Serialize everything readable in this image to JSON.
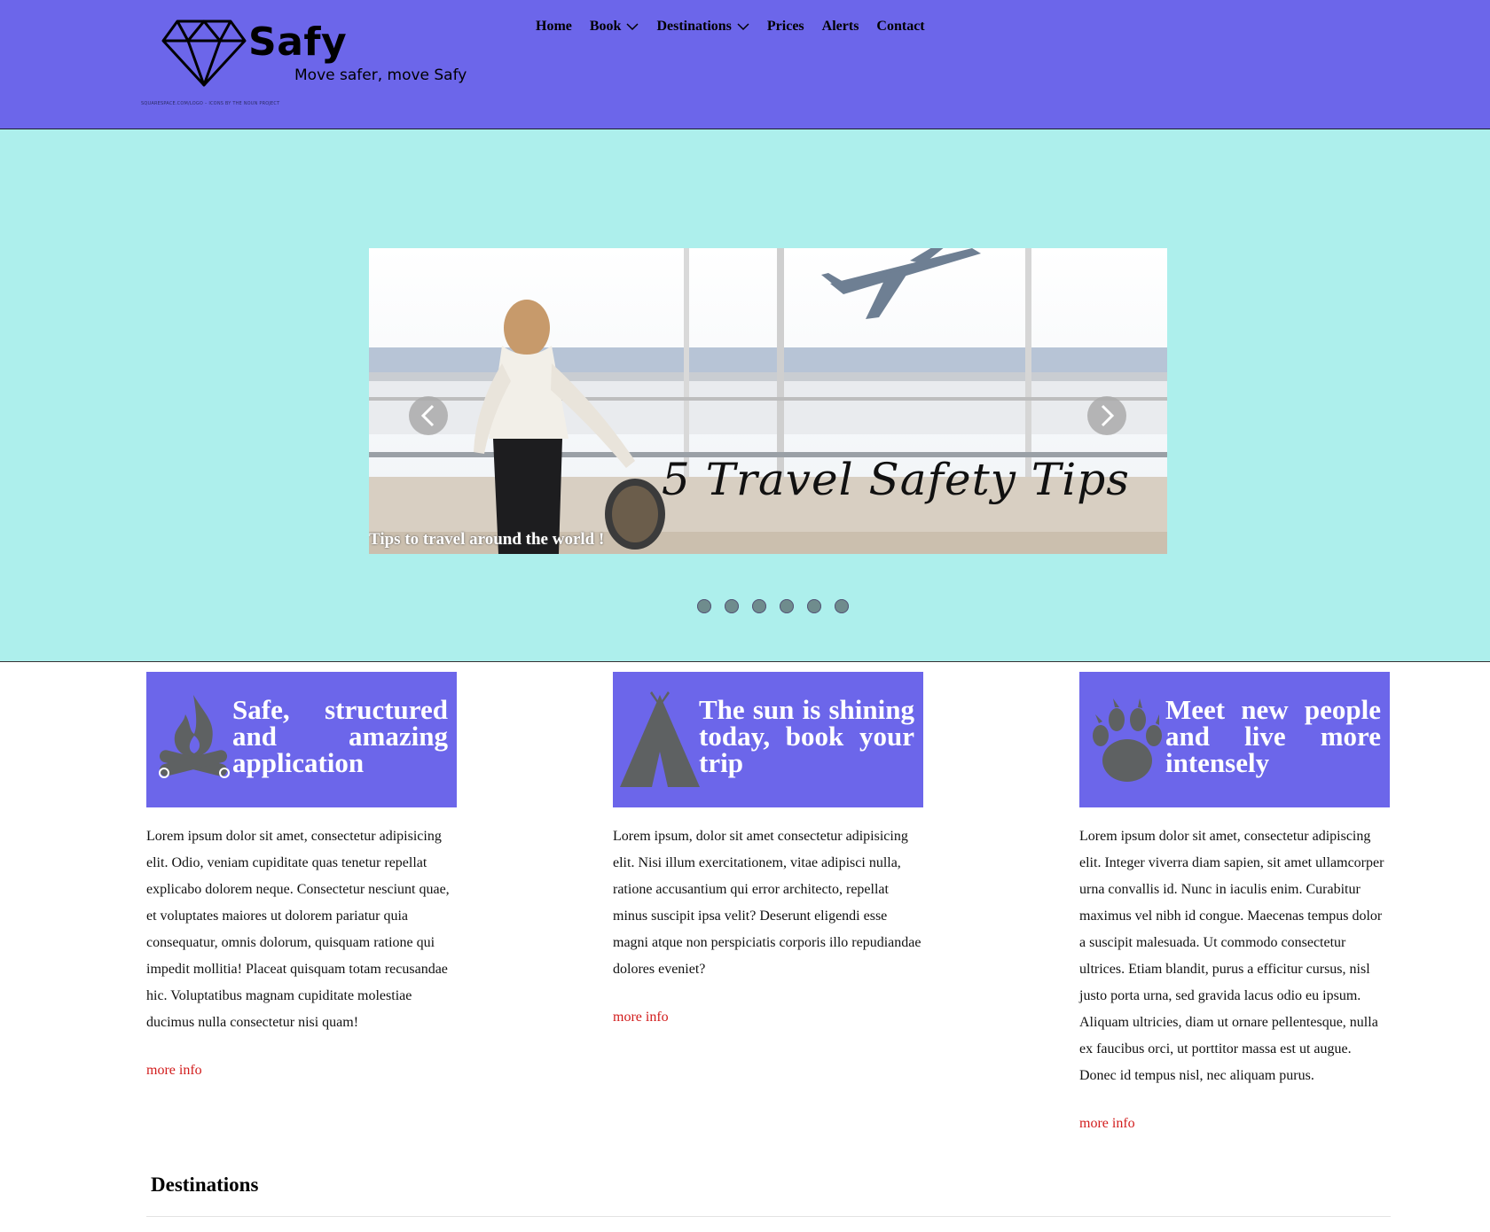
{
  "header": {
    "brand_name": "Safy",
    "tagline": "Move safer, move Safy",
    "credit": "SQUARESPACE.COM/LOGO – ICONS BY THE NOUN PROJECT"
  },
  "nav": {
    "items": [
      {
        "label": "Home",
        "has_dropdown": false
      },
      {
        "label": "Book",
        "has_dropdown": true
      },
      {
        "label": "Destinations",
        "has_dropdown": true
      },
      {
        "label": "Prices",
        "has_dropdown": false
      },
      {
        "label": "Alerts",
        "has_dropdown": false
      },
      {
        "label": "Contact",
        "has_dropdown": false
      }
    ]
  },
  "hero": {
    "slide_title": "5 Travel Safety Tips",
    "caption": "Tips to travel around the world !",
    "dot_count": 6,
    "background_color": "#adefec"
  },
  "features": [
    {
      "icon": "campfire-icon",
      "title": "Safe, structured and amazing application",
      "text": "Lorem ipsum dolor sit amet, consectetur adipisicing elit. Odio, veniam cupiditate quas tenetur repellat explicabo dolorem neque. Consectetur nesciunt quae, et voluptates maiores ut dolorem pariatur quia consequatur, omnis dolorum, quisquam ratione qui impedit mollitia! Placeat quisquam totam recusandae hic. Voluptatibus magnam cupiditate molestiae ducimus nulla consectetur nisi quam!",
      "link": "more info"
    },
    {
      "icon": "tent-icon",
      "title": "The sun is shining today, book your trip",
      "text": "Lorem ipsum, dolor sit amet consectetur adipisicing elit. Nisi illum exercitationem, vitae adipisci nulla, ratione accusantium qui error architecto, repellat minus suscipit ipsa velit? Deserunt eligendi esse magni atque non perspiciatis corporis illo repudiandae dolores eveniet?",
      "link": "more info"
    },
    {
      "icon": "paw-print-icon",
      "title": "Meet new people and live more intensely",
      "text": "Lorem ipsum dolor sit amet, consectetur adipiscing elit. Integer viverra diam sapien, sit amet ullamcorper urna convallis id. Nunc in iaculis enim. Curabitur maximus vel nibh id congue. Maecenas tempus dolor a suscipit malesuada. Ut commodo consectetur ultrices. Etiam blandit, purus a efficitur cursus, nisl justo porta urna, sed gravida lacus odio eu ipsum. Aliquam ultricies, diam ut ornare pellentesque, nulla ex faucibus orci, ut porttitor massa est ut augue. Donec id tempus nisl, nec aliquam purus.",
      "link": "more info"
    }
  ],
  "destinations": {
    "heading": "Destinations"
  },
  "colors": {
    "brand": "#6c66ea",
    "link": "#d21c1c",
    "icon_gray": "#5e6162"
  }
}
